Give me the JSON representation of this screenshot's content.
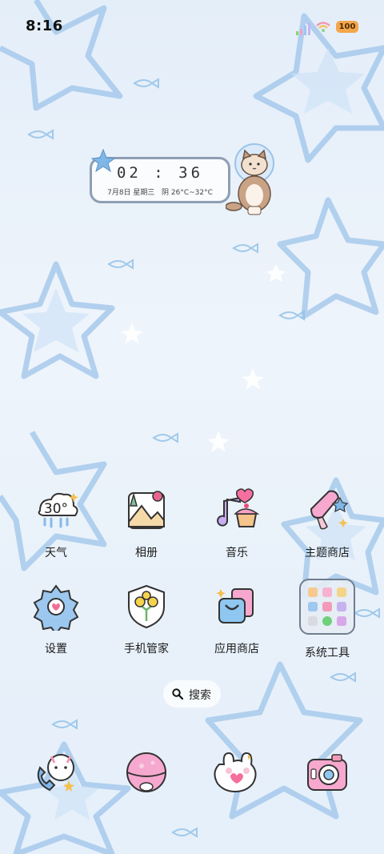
{
  "status_bar": {
    "time": "8:16",
    "battery": "100",
    "colors": {
      "battery": "#f4a64a"
    }
  },
  "clock_widget": {
    "time": "02 : 36",
    "date": "7月8日 星期三",
    "weather": "阴 26°C~32°C"
  },
  "weather_icon": {
    "temp": "30°"
  },
  "apps": [
    {
      "label": "天气",
      "icon": "weather-cloud-icon"
    },
    {
      "label": "相册",
      "icon": "gallery-icon"
    },
    {
      "label": "音乐",
      "icon": "music-icon"
    },
    {
      "label": "主题商店",
      "icon": "theme-store-icon"
    },
    {
      "label": "设置",
      "icon": "settings-gear-icon"
    },
    {
      "label": "手机管家",
      "icon": "phone-manager-icon"
    },
    {
      "label": "应用商店",
      "icon": "app-store-icon"
    },
    {
      "label": "系统工具",
      "icon": "system-tools-folder-icon"
    }
  ],
  "search": {
    "label": "搜索"
  },
  "dock": [
    {
      "icon": "phone-icon"
    },
    {
      "icon": "messages-icon"
    },
    {
      "icon": "browser-icon"
    },
    {
      "icon": "camera-icon"
    }
  ]
}
